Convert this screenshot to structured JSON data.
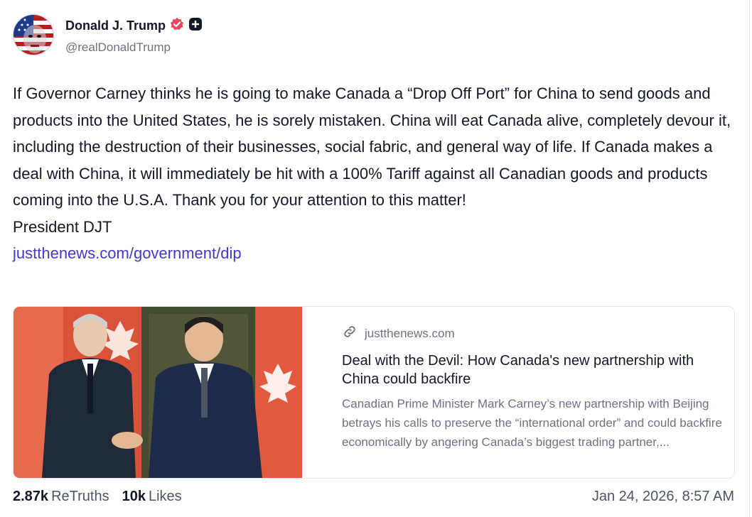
{
  "author": {
    "display_name": "Donald J. Trump",
    "handle": "@realDonaldTrump",
    "verified_icon": "verified-badge-icon",
    "extra_icon": "plus-badge-icon"
  },
  "post": {
    "body": "If Governor Carney thinks he is going to make Canada a “Drop Off Port” for China to send goods and products into the United States, he is sorely mistaken. China will eat Canada alive, completely devour it, including the destruction of their businesses, social fabric, and general way of life. If Canada makes a  deal with China, it will immediately be hit with a 100% Tariff against all Canadian goods and products coming into the U.S.A. Thank you for your attention to this matter!",
    "signature": "President DJT",
    "link_text": "justthenews.com/government/dip"
  },
  "link_card": {
    "domain": "justthenews.com",
    "title": "Deal with the Devil: How Canada's new partnership with China could backfire",
    "description": "Canadian Prime Minister Mark Carney’s new partnership with Beijing betrays his calls to preserve the “international order” and could backfire economically by angering Canada’s biggest trading partner,..."
  },
  "stats": {
    "retruths_count": "2.87k",
    "retruths_label": "ReTruths",
    "likes_count": "10k",
    "likes_label": "Likes"
  },
  "timestamp": "Jan 24, 2026, 8:57 AM",
  "colors": {
    "link": "#4338ca",
    "verified": "#e5485d",
    "text": "#111827",
    "muted": "#6b7280"
  }
}
